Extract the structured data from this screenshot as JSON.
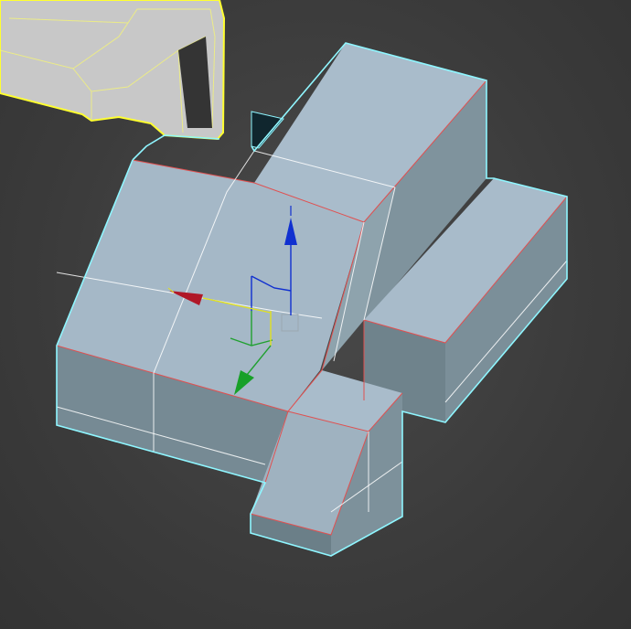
{
  "viewport": {
    "background": "#3b3b3b",
    "view": "perspective"
  },
  "colors": {
    "top_face": "#a9bccb",
    "front_face": "#7e929c",
    "side_face": "#8aa0aa",
    "selection_outline": "#8ff6ff",
    "selected_edges": "#e05050",
    "wire_edges": "#ffffff",
    "other_object_outline": "#ffff40",
    "other_object_fill": "#c9c9c9",
    "gizmo_x": "#c0202a",
    "gizmo_y": "#20a030",
    "gizmo_z": "#1030d0"
  },
  "scene": {
    "selected_object": "editable-poly-mesh",
    "other_object": "yellow-wireframe-object",
    "transform_gizmo": "move-gizmo",
    "gizmo_axes": [
      "x",
      "y",
      "z"
    ]
  }
}
